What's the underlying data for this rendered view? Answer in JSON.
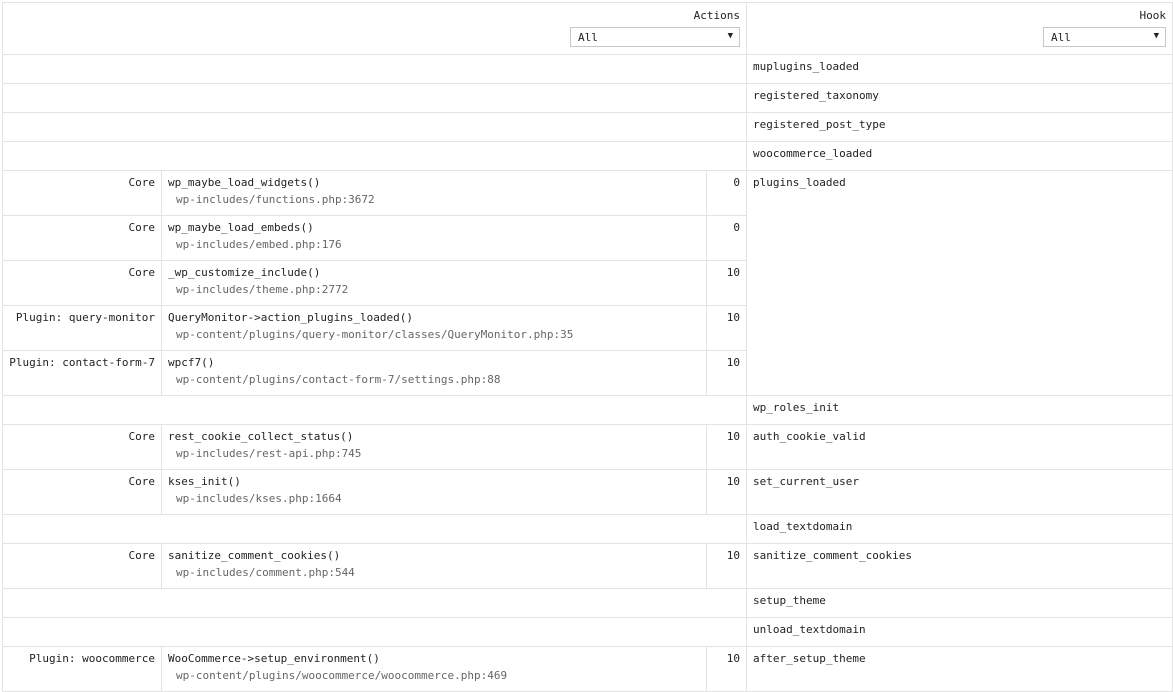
{
  "header": {
    "actions_label": "Actions",
    "actions_filter": "All",
    "hook_label": "Hook",
    "hook_filter": "All"
  },
  "rows": {
    "muplugins": {
      "hook": "muplugins_loaded"
    },
    "registered_taxonomy": {
      "hook": "registered_taxonomy"
    },
    "registered_post_type": {
      "hook": "registered_post_type"
    },
    "woocommerce_loaded": {
      "hook": "woocommerce_loaded"
    },
    "plugins_loaded": {
      "hook": "plugins_loaded",
      "callbacks": [
        {
          "component": "Core",
          "callback": "wp_maybe_load_widgets()",
          "file": "wp-includes/functions.php:3672",
          "priority": "0"
        },
        {
          "component": "Core",
          "callback": "wp_maybe_load_embeds()",
          "file": "wp-includes/embed.php:176",
          "priority": "0"
        },
        {
          "component": "Core",
          "callback": "_wp_customize_include()",
          "file": "wp-includes/theme.php:2772",
          "priority": "10"
        },
        {
          "component": "Plugin: query-monitor",
          "callback": "QueryMonitor->action_plugins_loaded()",
          "file": "wp-content/plugins/query-monitor/classes/QueryMonitor.php:35",
          "priority": "10"
        },
        {
          "component": "Plugin: contact-form-7",
          "callback": "wpcf7()",
          "file": "wp-content/plugins/contact-form-7/settings.php:88",
          "priority": "10"
        }
      ]
    },
    "wp_roles_init": {
      "hook": "wp_roles_init"
    },
    "auth_cookie_valid": {
      "hook": "auth_cookie_valid",
      "callbacks": [
        {
          "component": "Core",
          "callback": "rest_cookie_collect_status()",
          "file": "wp-includes/rest-api.php:745",
          "priority": "10"
        }
      ]
    },
    "set_current_user": {
      "hook": "set_current_user",
      "callbacks": [
        {
          "component": "Core",
          "callback": "kses_init()",
          "file": "wp-includes/kses.php:1664",
          "priority": "10"
        }
      ]
    },
    "load_textdomain": {
      "hook": "load_textdomain"
    },
    "sanitize_comment_cookies": {
      "hook": "sanitize_comment_cookies",
      "callbacks": [
        {
          "component": "Core",
          "callback": "sanitize_comment_cookies()",
          "file": "wp-includes/comment.php:544",
          "priority": "10"
        }
      ]
    },
    "setup_theme": {
      "hook": "setup_theme"
    },
    "unload_textdomain": {
      "hook": "unload_textdomain"
    },
    "after_setup_theme": {
      "hook": "after_setup_theme",
      "callbacks": [
        {
          "component": "Plugin: woocommerce",
          "callback": "WooCommerce->setup_environment()",
          "file": "wp-content/plugins/woocommerce/woocommerce.php:469",
          "priority": "10"
        }
      ]
    }
  }
}
